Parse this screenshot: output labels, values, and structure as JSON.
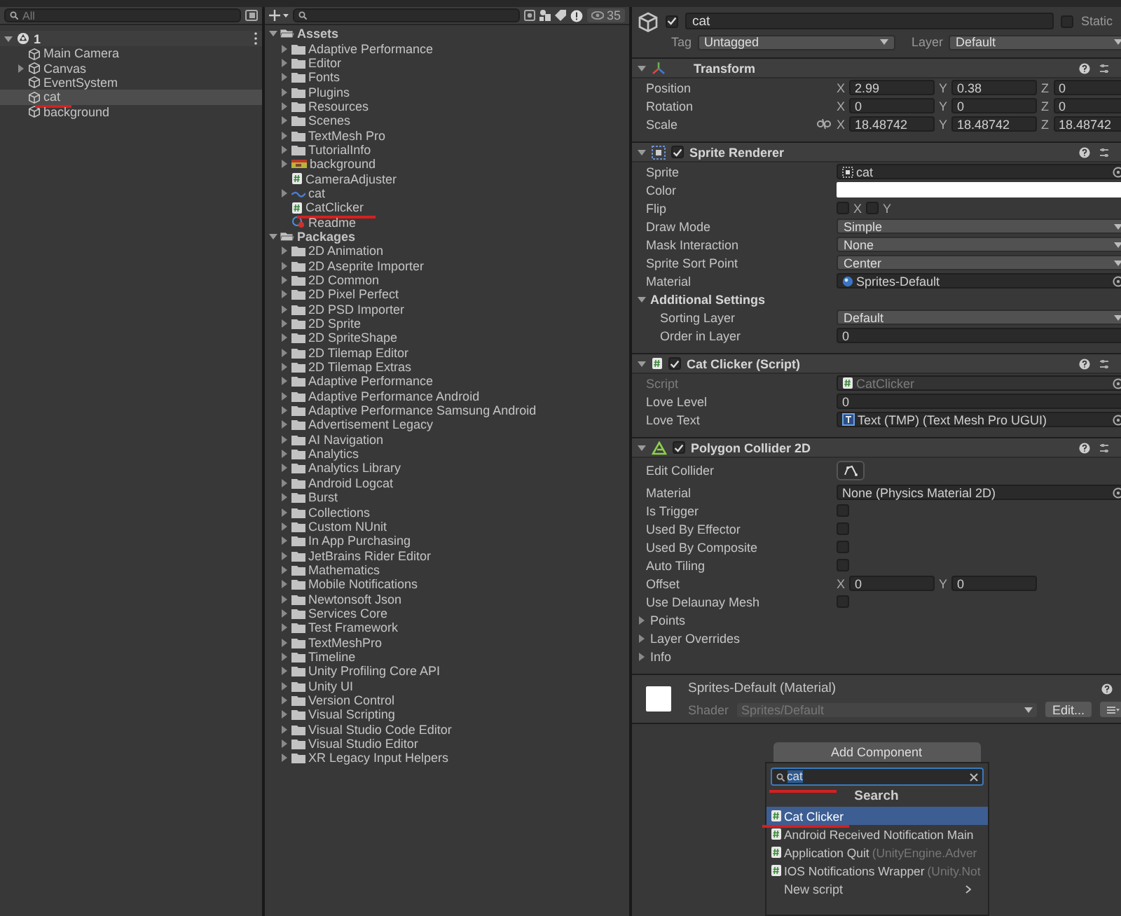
{
  "hierarchy": {
    "search": {
      "placeholder": "All"
    },
    "scene": {
      "name": "1",
      "expanded": true
    },
    "items": [
      {
        "name": "Main Camera",
        "selected": false,
        "underlined": false
      },
      {
        "name": "Canvas",
        "selected": false,
        "underlined": false,
        "expanded": false
      },
      {
        "name": "EventSystem",
        "selected": false,
        "underlined": false
      },
      {
        "name": "cat",
        "selected": true,
        "underlined": true
      },
      {
        "name": "background",
        "selected": false,
        "underlined": false
      }
    ]
  },
  "project": {
    "count": "35",
    "sections": [
      {
        "name": "Assets",
        "kind": "folder",
        "expanded": true,
        "children": [
          {
            "name": "Adaptive Performance",
            "kind": "folder",
            "expanded": false,
            "underlined": false
          },
          {
            "name": "Editor",
            "kind": "folder",
            "expanded": false,
            "underlined": false
          },
          {
            "name": "Fonts",
            "kind": "folder",
            "expanded": false,
            "underlined": false
          },
          {
            "name": "Plugins",
            "kind": "folder",
            "expanded": false,
            "underlined": false
          },
          {
            "name": "Resources",
            "kind": "folder",
            "expanded": false,
            "underlined": false
          },
          {
            "name": "Scenes",
            "kind": "folder",
            "expanded": false,
            "underlined": false
          },
          {
            "name": "TextMesh Pro",
            "kind": "folder",
            "expanded": false,
            "underlined": false
          },
          {
            "name": "TutorialInfo",
            "kind": "folder",
            "expanded": false,
            "underlined": false
          },
          {
            "name": "background",
            "kind": "texture",
            "expanded": false,
            "underlined": false
          },
          {
            "name": "CameraAdjuster",
            "kind": "script",
            "underlined": false
          },
          {
            "name": "cat",
            "kind": "sprite",
            "expanded": false,
            "underlined": false
          },
          {
            "name": "CatClicker",
            "kind": "script",
            "underlined": true
          },
          {
            "name": "Readme",
            "kind": "readme",
            "underlined": false
          }
        ]
      },
      {
        "name": "Packages",
        "kind": "folder",
        "expanded": true,
        "children": [
          {
            "name": "2D Animation",
            "kind": "package",
            "expanded": false
          },
          {
            "name": "2D Aseprite Importer",
            "kind": "package",
            "expanded": false
          },
          {
            "name": "2D Common",
            "kind": "package",
            "expanded": false
          },
          {
            "name": "2D Pixel Perfect",
            "kind": "package",
            "expanded": false
          },
          {
            "name": "2D PSD Importer",
            "kind": "package",
            "expanded": false
          },
          {
            "name": "2D Sprite",
            "kind": "package",
            "expanded": false
          },
          {
            "name": "2D SpriteShape",
            "kind": "package",
            "expanded": false
          },
          {
            "name": "2D Tilemap Editor",
            "kind": "package",
            "expanded": false
          },
          {
            "name": "2D Tilemap Extras",
            "kind": "package",
            "expanded": false
          },
          {
            "name": "Adaptive Performance",
            "kind": "package",
            "expanded": false
          },
          {
            "name": "Adaptive Performance Android",
            "kind": "package",
            "expanded": false
          },
          {
            "name": "Adaptive Performance Samsung Android",
            "kind": "package",
            "expanded": false
          },
          {
            "name": "Advertisement Legacy",
            "kind": "package",
            "expanded": false
          },
          {
            "name": "AI Navigation",
            "kind": "package",
            "expanded": false
          },
          {
            "name": "Analytics",
            "kind": "package",
            "expanded": false
          },
          {
            "name": "Analytics Library",
            "kind": "package",
            "expanded": false
          },
          {
            "name": "Android Logcat",
            "kind": "package",
            "expanded": false
          },
          {
            "name": "Burst",
            "kind": "package",
            "expanded": false
          },
          {
            "name": "Collections",
            "kind": "package",
            "expanded": false
          },
          {
            "name": "Custom NUnit",
            "kind": "package",
            "expanded": false
          },
          {
            "name": "In App Purchasing",
            "kind": "package",
            "expanded": false
          },
          {
            "name": "JetBrains Rider Editor",
            "kind": "package",
            "expanded": false
          },
          {
            "name": "Mathematics",
            "kind": "package",
            "expanded": false
          },
          {
            "name": "Mobile Notifications",
            "kind": "package",
            "expanded": false
          },
          {
            "name": "Newtonsoft Json",
            "kind": "package",
            "expanded": false
          },
          {
            "name": "Services Core",
            "kind": "package",
            "expanded": false
          },
          {
            "name": "Test Framework",
            "kind": "package",
            "expanded": false
          },
          {
            "name": "TextMeshPro",
            "kind": "package",
            "expanded": false
          },
          {
            "name": "Timeline",
            "kind": "package",
            "expanded": false
          },
          {
            "name": "Unity Profiling Core API",
            "kind": "package",
            "expanded": false
          },
          {
            "name": "Unity UI",
            "kind": "package",
            "expanded": false
          },
          {
            "name": "Version Control",
            "kind": "package",
            "expanded": false
          },
          {
            "name": "Visual Scripting",
            "kind": "package",
            "expanded": false
          },
          {
            "name": "Visual Studio Code Editor",
            "kind": "package",
            "expanded": false
          },
          {
            "name": "Visual Studio Editor",
            "kind": "package",
            "expanded": false
          },
          {
            "name": "XR Legacy Input Helpers",
            "kind": "package",
            "expanded": false
          }
        ]
      }
    ]
  },
  "inspector": {
    "object": {
      "active": true,
      "name": "cat",
      "static_label": "Static",
      "static": false,
      "tag_label": "Tag",
      "tag": "Untagged",
      "layer_label": "Layer",
      "layer": "Default"
    },
    "components": [
      {
        "kind": "transform",
        "title": "Transform",
        "expanded": true,
        "rows": [
          {
            "kind": "vector",
            "label": "Position",
            "fields": [
              {
                "axis": "X",
                "value": "2.99"
              },
              {
                "axis": "Y",
                "value": "0.38"
              },
              {
                "axis": "Z",
                "value": "0"
              }
            ]
          },
          {
            "kind": "vector",
            "label": "Rotation",
            "fields": [
              {
                "axis": "X",
                "value": "0"
              },
              {
                "axis": "Y",
                "value": "0"
              },
              {
                "axis": "Z",
                "value": "0"
              }
            ]
          },
          {
            "kind": "vector",
            "label": "Scale",
            "constrained": false,
            "fields": [
              {
                "axis": "X",
                "value": "18.48742"
              },
              {
                "axis": "Y",
                "value": "18.48742"
              },
              {
                "axis": "Z",
                "value": "18.48742"
              }
            ]
          }
        ]
      },
      {
        "kind": "sprite_renderer",
        "title": "Sprite Renderer",
        "expanded": true,
        "enabled": true,
        "rows": [
          {
            "kind": "object",
            "label": "Sprite",
            "value": {
              "kind": "sprite",
              "text": "cat"
            }
          },
          {
            "kind": "color",
            "label": "Color",
            "color": "#ffffff"
          },
          {
            "kind": "toggles",
            "label": "Flip",
            "fields": [
              {
                "axis": "X",
                "checked": false
              },
              {
                "axis": "Y",
                "checked": false
              }
            ]
          },
          {
            "kind": "dropdown",
            "label": "Draw Mode",
            "value": "Simple"
          },
          {
            "kind": "dropdown",
            "label": "Mask Interaction",
            "value": "None"
          },
          {
            "kind": "dropdown",
            "label": "Sprite Sort Point",
            "value": "Center"
          },
          {
            "kind": "object",
            "label": "Material",
            "value": {
              "kind": "material",
              "text": "Sprites-Default"
            }
          },
          {
            "kind": "section",
            "label": "Additional Settings",
            "expanded": true,
            "children": [
              {
                "kind": "dropdown",
                "label": "Sorting Layer",
                "value": "Default"
              },
              {
                "kind": "text",
                "label": "Order in Layer",
                "value": "0"
              }
            ]
          }
        ]
      },
      {
        "kind": "script",
        "title": "Cat Clicker (Script)",
        "expanded": true,
        "enabled": true,
        "rows": [
          {
            "kind": "object",
            "label": "Script",
            "value": {
              "kind": "script",
              "text": "CatClicker"
            },
            "disabled": true
          },
          {
            "kind": "text",
            "label": "Love Level",
            "value": "0"
          },
          {
            "kind": "object",
            "label": "Love Text",
            "value": {
              "kind": "text",
              "text": "Text (TMP) (Text Mesh Pro UGUI)"
            }
          }
        ]
      },
      {
        "kind": "polygon_collider",
        "title": "Polygon Collider 2D",
        "expanded": true,
        "enabled": true,
        "rows": [
          {
            "kind": "button",
            "label": "Edit Collider"
          },
          {
            "kind": "object",
            "label": "Material",
            "value": {
              "kind": "none",
              "text": "None (Physics Material 2D)"
            }
          },
          {
            "kind": "checkbox",
            "label": "Is Trigger",
            "checked": false
          },
          {
            "kind": "checkbox",
            "label": "Used By Effector",
            "checked": false
          },
          {
            "kind": "checkbox",
            "label": "Used By Composite",
            "checked": false
          },
          {
            "kind": "checkbox",
            "label": "Auto Tiling",
            "checked": false
          },
          {
            "kind": "vector",
            "label": "Offset",
            "fields": [
              {
                "axis": "X",
                "value": "0"
              },
              {
                "axis": "Y",
                "value": "0"
              }
            ]
          },
          {
            "kind": "checkbox",
            "label": "Use Delaunay Mesh",
            "checked": false
          },
          {
            "kind": "foldout",
            "label": "Points",
            "expanded": false
          },
          {
            "kind": "foldout",
            "label": "Layer Overrides",
            "expanded": false
          },
          {
            "kind": "foldout",
            "label": "Info",
            "expanded": false
          }
        ]
      }
    ],
    "material": {
      "name": "Sprites-Default (Material)",
      "shader_label": "Shader",
      "shader": "Sprites/Default",
      "edit_button": "Edit..."
    },
    "add_component": {
      "button": "Add Component",
      "search": {
        "value": "cat",
        "underlined": true
      },
      "heading": "Search",
      "results": [
        {
          "label": "Cat Clicker",
          "selected": true,
          "underlined": true
        },
        {
          "label": "Android Received Notification Main",
          "selected": false,
          "underlined": false
        },
        {
          "label": "Application Quit",
          "detail": "(UnityEngine.Adver",
          "selected": false,
          "underlined": false
        },
        {
          "label": "IOS Notifications Wrapper",
          "detail": "(Unity.Not",
          "selected": false,
          "underlined": false
        }
      ],
      "new_script": "New script"
    }
  }
}
